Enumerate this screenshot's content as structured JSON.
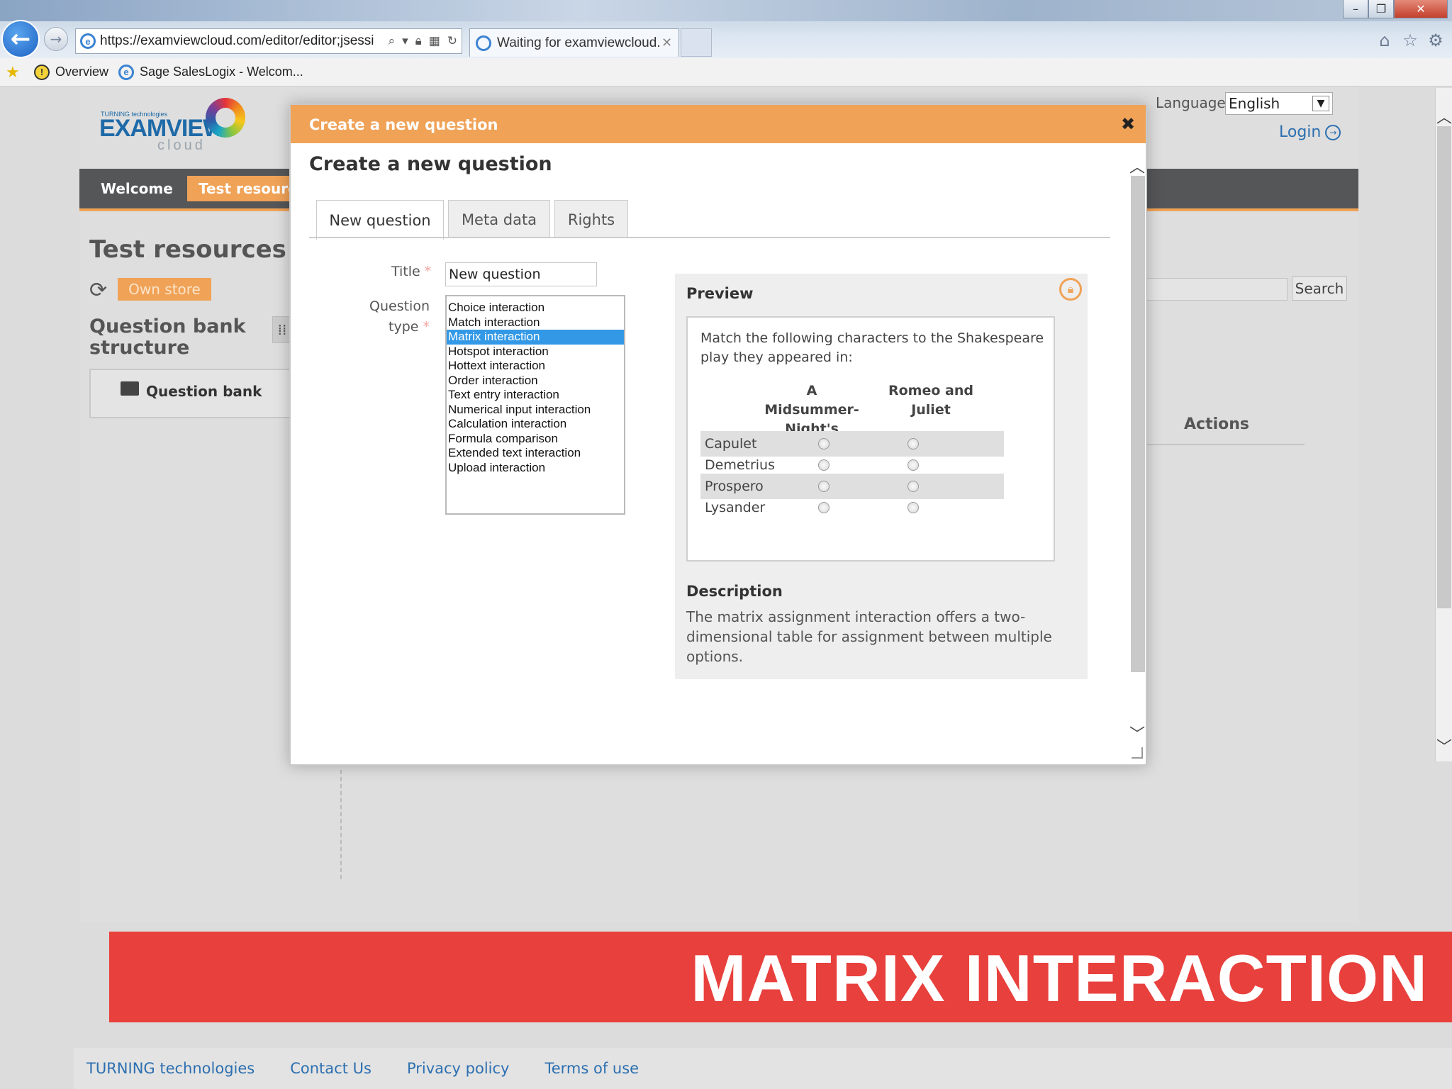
{
  "browser": {
    "url": "https://examviewcloud.com/editor/editor;jsessi",
    "tab_title": "Waiting for examviewcloud...",
    "favorites": [
      "Overview",
      "Sage SalesLogix - Welcom..."
    ]
  },
  "site": {
    "logo": {
      "tagline": "TURNING technologies",
      "brand": "EXAMVIEW",
      "sub": "cloud"
    },
    "language_label": "Language",
    "language_value": "English",
    "login_label": "Login",
    "nav": {
      "welcome": "Welcome",
      "test_resources": "Test resources"
    },
    "page_title": "Test resources",
    "own_store": "Own store",
    "qb_structure_title": "Question bank structure",
    "qb_node": "Question bank",
    "search_button": "Search",
    "actions_header": "Actions"
  },
  "modal": {
    "header": "Create a new question",
    "title": "Create a new question",
    "tabs": [
      "New question",
      "Meta data",
      "Rights"
    ],
    "form": {
      "title_label": "Title",
      "title_value": "New question",
      "qtype_label_1": "Question",
      "qtype_label_2": "type",
      "question_types": [
        "Choice interaction",
        "Match interaction",
        "Matrix interaction",
        "Hotspot interaction",
        "Hottext interaction",
        "Order interaction",
        "Text entry interaction",
        "Numerical input interaction",
        "Calculation interaction",
        "Formula comparison",
        "Extended text interaction",
        "Upload interaction"
      ],
      "selected_type": "Matrix interaction"
    },
    "preview": {
      "title": "Preview",
      "prompt": "Match the following characters to the Shakespeare play they appeared in:",
      "columns": [
        "A Midsummer-Night's Dream",
        "Romeo and Juliet"
      ],
      "rows": [
        "Capulet",
        "Demetrius",
        "Prospero",
        "Lysander"
      ],
      "description_title": "Description",
      "description": "The matrix assignment interaction offers a two-dimensional table for assignment between multiple options."
    }
  },
  "banner": "MATRIX INTERACTION",
  "footer_links": [
    "TURNING technologies",
    "Contact Us",
    "Privacy policy",
    "Terms of use"
  ],
  "colors": {
    "accent": "#f0a257",
    "banner": "#e8403c",
    "link": "#2c6fb0",
    "selection": "#3399e6"
  }
}
